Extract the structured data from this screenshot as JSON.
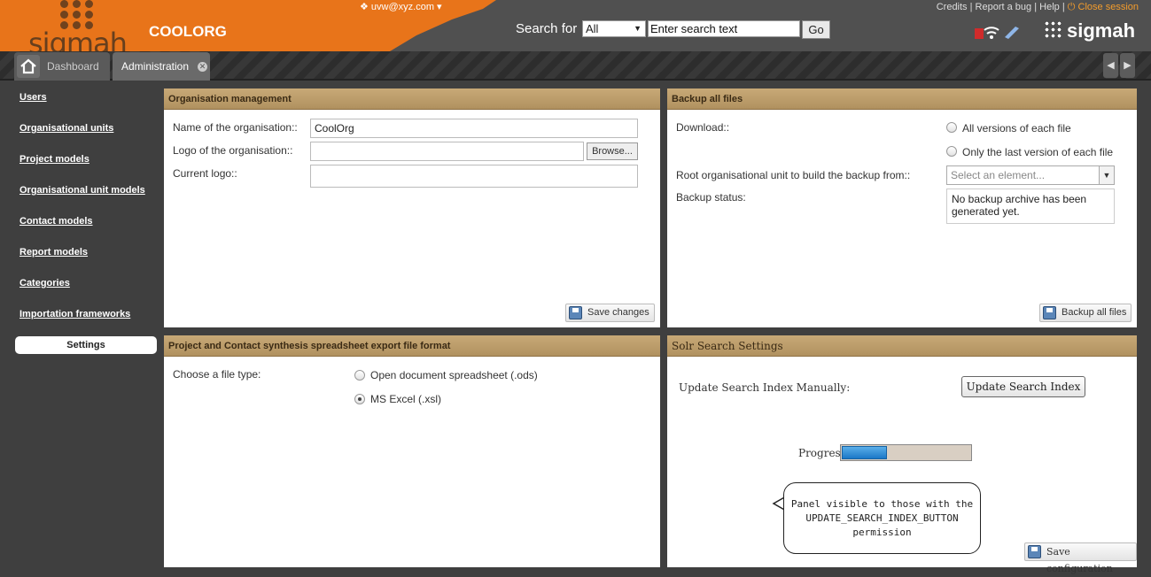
{
  "header": {
    "org_name": "COOLORG",
    "user_menu": "uvw@xyz.com ▾",
    "search_label": "Search for",
    "search_scope": "All",
    "search_placeholder": "Enter search text",
    "go_label": "Go",
    "links": [
      "Credits",
      "Report a bug",
      "Help"
    ],
    "close_session": "Close session",
    "brand_left": "sigmah",
    "brand_right": "sigmah",
    "accent_color": "#e8741a"
  },
  "tabs": {
    "dashboard": "Dashboard",
    "administration": "Administration"
  },
  "sidebar": {
    "items": [
      "Users",
      "Organisational units",
      "Project models",
      "Organisational unit models",
      "Contact models",
      "Report models",
      "Categories",
      "Importation frameworks"
    ],
    "selected": "Settings"
  },
  "org_panel": {
    "title": "Organisation management",
    "name_label": "Name of the organisation::",
    "name_value": "CoolOrg",
    "logo_label": "Logo of the organisation::",
    "browse_label": "Browse...",
    "current_logo_label": "Current logo::",
    "save_label": "Save changes"
  },
  "backup_panel": {
    "title": "Backup all files",
    "download_label": "Download::",
    "option_all": "All versions of each file",
    "option_last": "Only the last version of each file",
    "root_label": "Root organisational unit to build the backup from::",
    "root_placeholder": "Select an element...",
    "status_label": "Backup status:",
    "status_text": "No backup archive has been generated yet.",
    "backup_button": "Backup all files"
  },
  "export_panel": {
    "title": "Project and Contact synthesis spreadsheet export file format",
    "file_type_label": "Choose a file type:",
    "option_ods": "Open document spreadsheet (.ods)",
    "option_xsl": "MS Excel (.xsl)",
    "selected": "xsl"
  },
  "solr_panel": {
    "title": "Solr Search Settings",
    "update_label": "Update Search Index Manually:",
    "update_button": "Update Search Index",
    "progress_label": "Progress:",
    "progress_fraction": 0.35,
    "note_line1": "Panel visible to those with the",
    "note_line2": "UPDATE_SEARCH_INDEX_BUTTON",
    "note_line3": "permission",
    "save_label": "Save configuration"
  }
}
